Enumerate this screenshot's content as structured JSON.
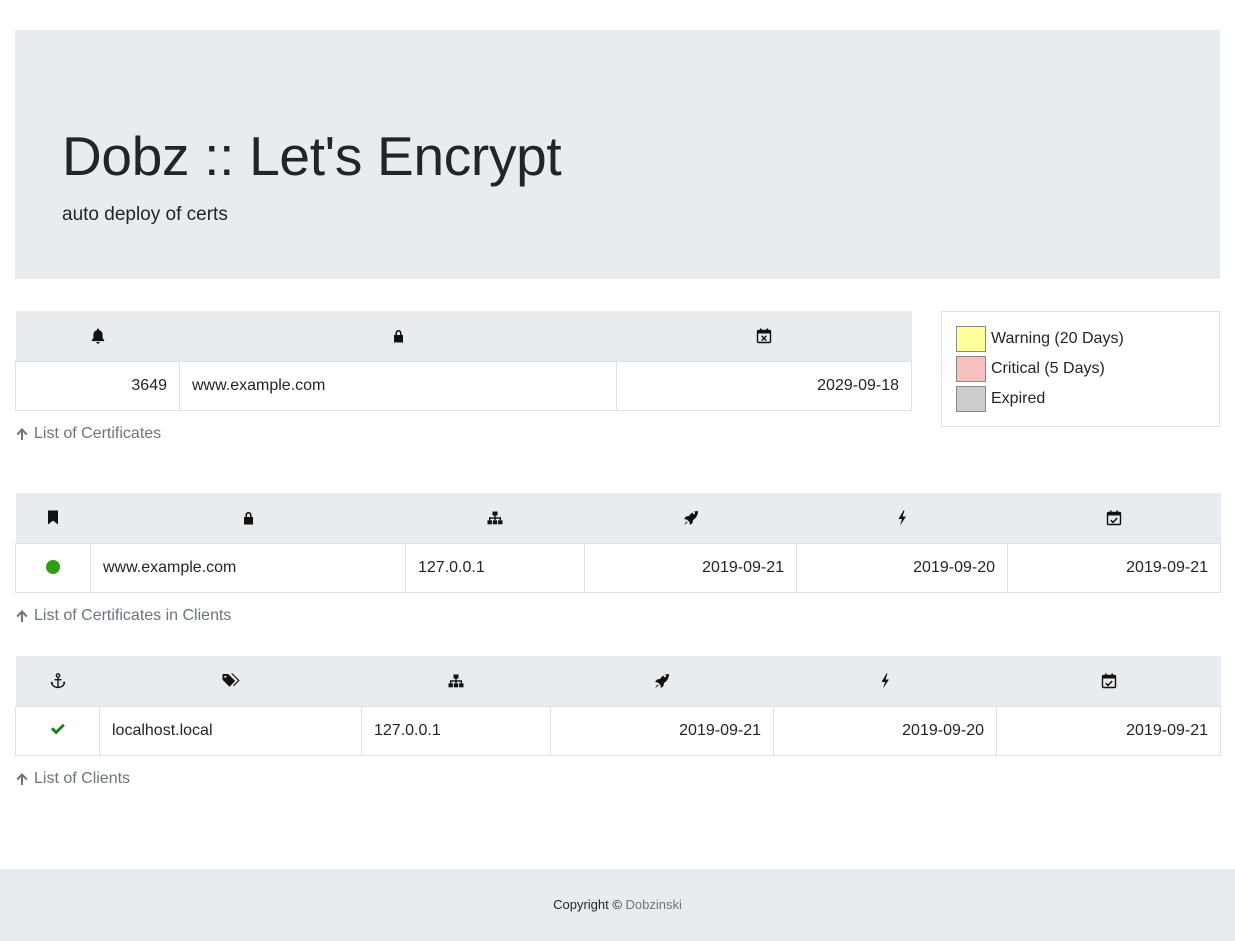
{
  "header": {
    "title": "Dobz :: Let's Encrypt",
    "subtitle": "auto deploy of certs"
  },
  "certificates": {
    "columns": [
      "bell-icon",
      "lock-icon",
      "calendar-x-icon"
    ],
    "rows": [
      {
        "days": "3649",
        "domain": "www.example.com",
        "expires": "2029-09-18"
      }
    ],
    "link_label": "List of Certificates"
  },
  "legend": {
    "items": [
      {
        "label": "Warning (20 Days)",
        "color": "#ffff99"
      },
      {
        "label": "Critical (5 Days)",
        "color": "#f5c0bd"
      },
      {
        "label": "Expired",
        "color": "#cccccc"
      }
    ]
  },
  "client_certs": {
    "columns": [
      "bookmark-icon",
      "lock-icon",
      "sitemap-icon",
      "rocket-icon",
      "bolt-icon",
      "calendar-check-icon"
    ],
    "rows": [
      {
        "status_color": "#2e9e15",
        "domain": "www.example.com",
        "ip": "127.0.0.1",
        "deployed": "2019-09-21",
        "renewed": "2019-09-20",
        "checked": "2019-09-21"
      }
    ],
    "link_label": "List of Certificates in Clients"
  },
  "clients": {
    "columns": [
      "anchor-icon",
      "tags-icon",
      "sitemap-icon",
      "rocket-icon",
      "bolt-icon",
      "calendar-check-icon"
    ],
    "rows": [
      {
        "status_color": "#1a7f1a",
        "host": "localhost.local",
        "ip": "127.0.0.1",
        "deployed": "2019-09-21",
        "renewed": "2019-09-20",
        "checked": "2019-09-21"
      }
    ],
    "link_label": "List of Clients"
  },
  "footer": {
    "copyright": "Copyright ©",
    "author": "Dobzinski"
  }
}
